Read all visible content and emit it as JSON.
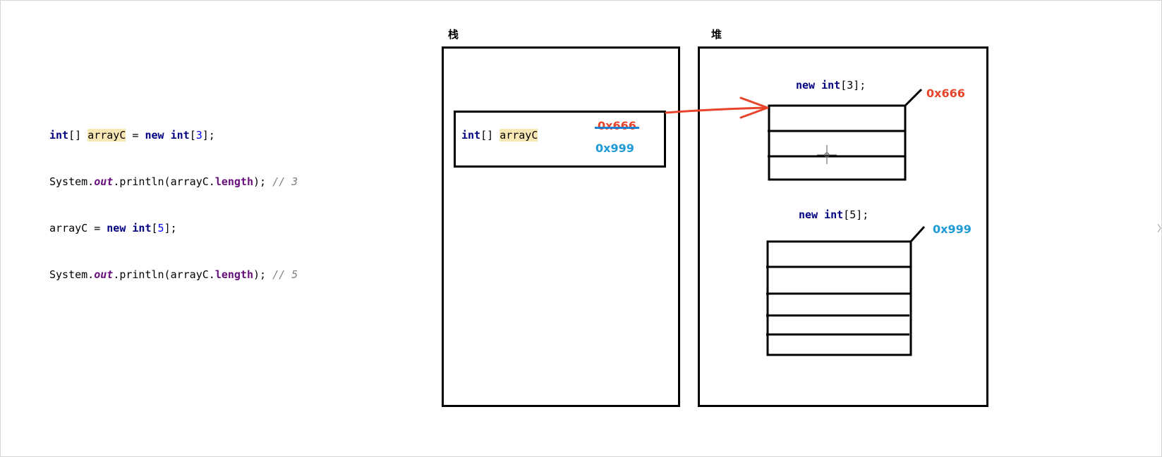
{
  "code": {
    "line1": {
      "kw1": "int",
      "t1": "[] ",
      "var": "arrayC",
      "t2": " = ",
      "kw2": "new",
      "t3": " ",
      "kw3": "int",
      "t4": "[",
      "num": "3",
      "t5": "];"
    },
    "line2": {
      "t1": "System.",
      "fld1": "out",
      "t2": ".println(arrayC.",
      "fld2": "length",
      "t3": "); ",
      "cmt": "// 3"
    },
    "line3": {
      "t1": "arrayC = ",
      "kw1": "new",
      "t2": " ",
      "kw2": "int",
      "t3": "[",
      "num": "5",
      "t4": "];"
    },
    "line4": {
      "t1": "System.",
      "fld1": "out",
      "t2": ".println(arrayC.",
      "fld2": "length",
      "t3": "); ",
      "cmt": "// 5"
    }
  },
  "stack": {
    "title": "栈",
    "var": {
      "kw": "int",
      "brackets": "[] ",
      "name": "arrayC"
    },
    "old_address": "0x666",
    "new_address": "0x999"
  },
  "heap": {
    "title": "堆",
    "array1": {
      "kw_new": "new",
      "kw_int": "int",
      "open": " ",
      "bracket": "[3];",
      "address": "0x666",
      "cells": 3
    },
    "array2": {
      "kw_new": "new",
      "kw_int": "int",
      "open": " ",
      "bracket": "[5];",
      "address": "0x999",
      "cells": 5
    }
  },
  "colors": {
    "arrow": "#e8442b",
    "old_address": "#e8442b",
    "new_address": "#1e9ad6",
    "highlight": "#f7e7b4"
  }
}
